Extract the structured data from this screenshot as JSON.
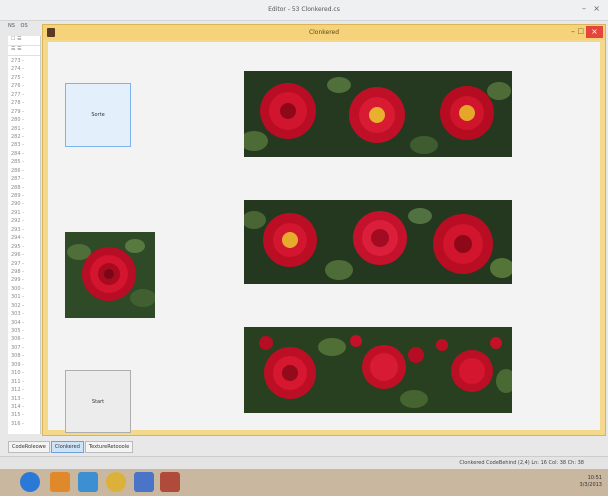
{
  "outer": {
    "title": "Editor - 53 Clonkered.cs",
    "minimize": "–",
    "close": "×"
  },
  "left_tabs": [
    "NS",
    "OS"
  ],
  "gutter": {
    "tools": [
      "☐ ☰",
      "☰ ☰"
    ],
    "line_numbers": [
      "273",
      "274",
      "275",
      "276",
      "277",
      "278",
      "279",
      "280",
      "281",
      "282",
      "283",
      "284",
      "285",
      "286",
      "287",
      "288",
      "289",
      "290",
      "291",
      "292",
      "293",
      "294",
      "295",
      "296",
      "297",
      "298",
      "299",
      "300",
      "301",
      "302",
      "303",
      "304",
      "305",
      "306",
      "307",
      "308",
      "309",
      "310",
      "311",
      "312",
      "313",
      "314",
      "315",
      "316"
    ]
  },
  "form": {
    "title": "Clonkered",
    "minimize": "–",
    "maximize": "□",
    "close": "×",
    "top_button_label": "Sorte",
    "bottom_button_label": "Start"
  },
  "bottom_tabs": [
    "CodeRoleowe",
    "Clonkered",
    "TextureRetooole"
  ],
  "status": {
    "text": "Clonkered  CodeBehind  (2,4)    Ln: 16   Col: 38   Ch: 38"
  },
  "tray": {
    "time": "10:51",
    "date": "3/3/2013"
  },
  "colors": {
    "form_frame": "#f4d88c",
    "close_red": "#e4463c",
    "rose_red": "#c8102e",
    "foliage": "#2f4a27"
  }
}
